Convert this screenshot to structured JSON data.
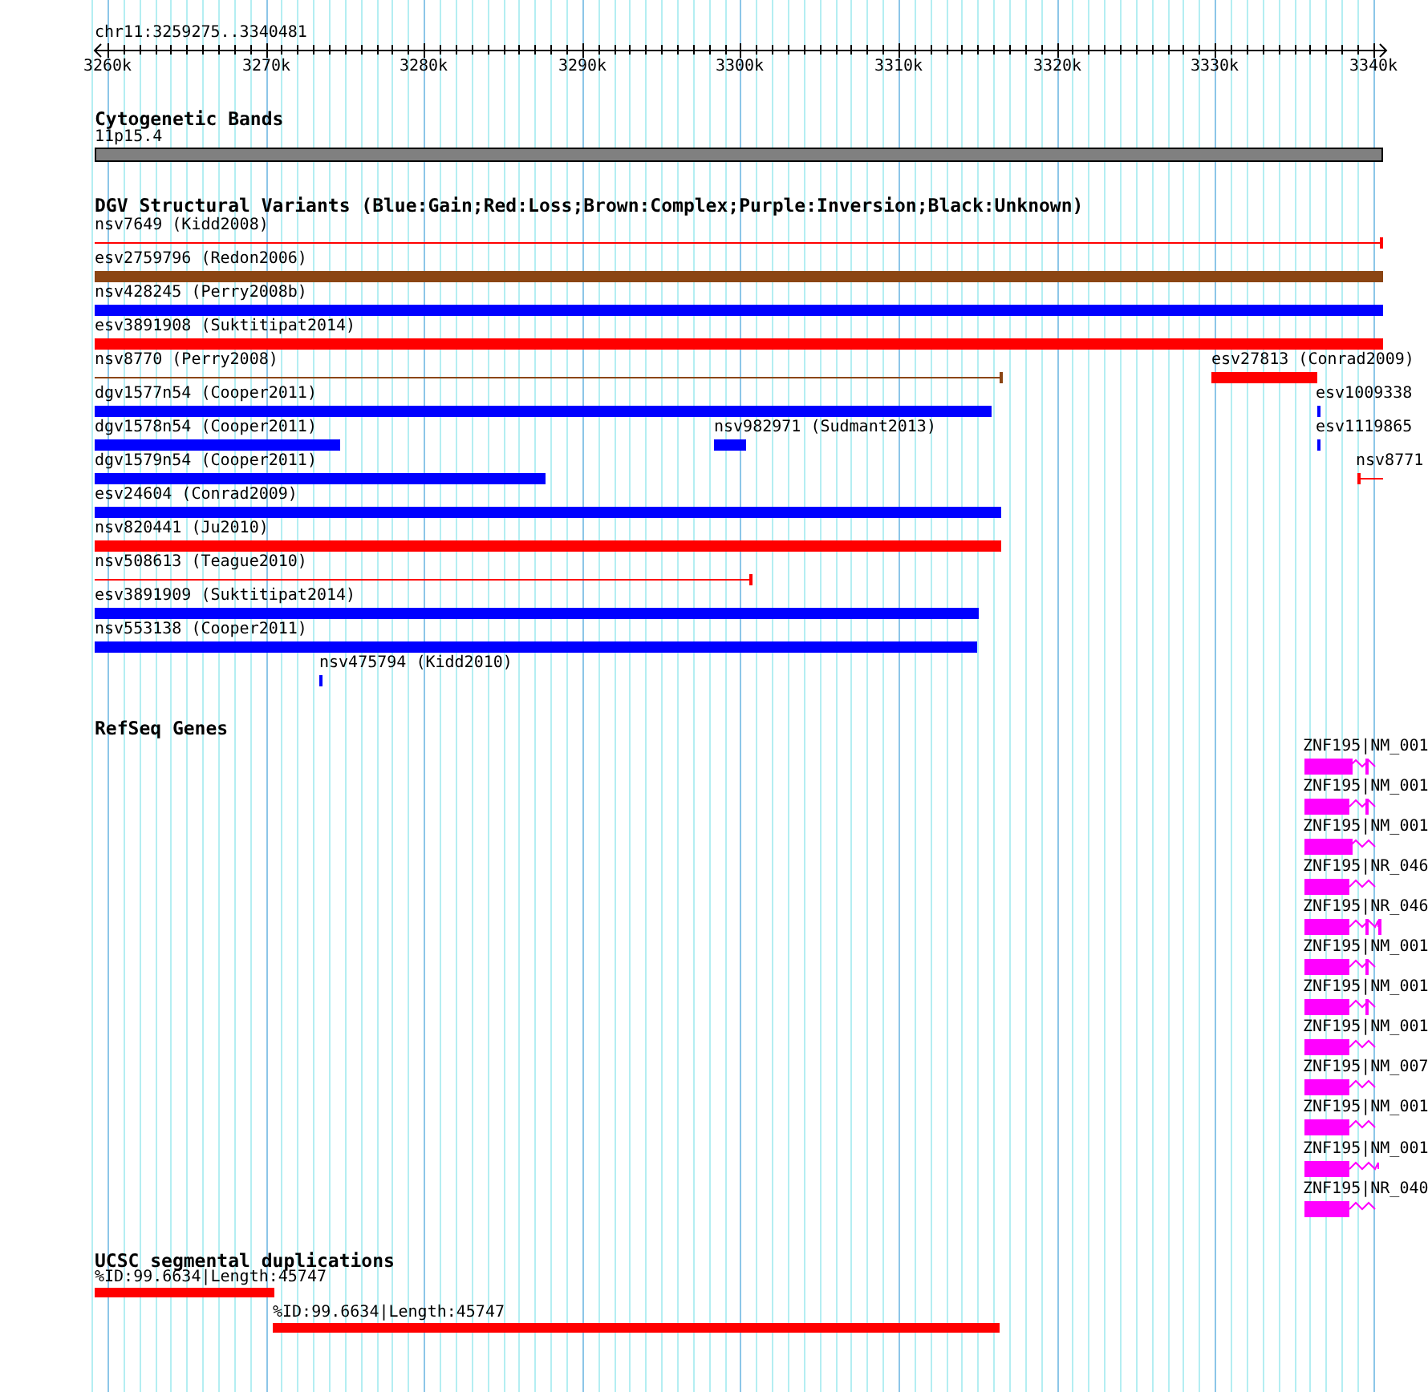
{
  "ruler": {
    "region": "chr11:3259275..3340481",
    "ticks": [
      "3260k",
      "3270k",
      "3280k",
      "3290k",
      "3300k",
      "3310k",
      "3320k",
      "3330k",
      "3340k"
    ]
  },
  "tracks": [
    {
      "kind": "cytoband",
      "title": "Cytogenetic Bands",
      "features": [
        {
          "label": "11p15.4"
        }
      ]
    },
    {
      "kind": "variants",
      "title": "DGV Structural Variants (Blue:Gain;Red:Loss;Brown:Complex;Purple:Inversion;Black:Unknown)",
      "features": [
        {
          "label": "nsv7649 (Kidd2008)",
          "kind": "line",
          "color": "#ff0000"
        },
        {
          "label": "esv2759796 (Redon2006)",
          "kind": "bar",
          "color": "#8b4513"
        },
        {
          "label": "nsv428245 (Perry2008b)",
          "kind": "bar",
          "color": "#0000ff"
        },
        {
          "label": "esv3891908 (Suktitipat2014)",
          "kind": "bar",
          "color": "#ff0000"
        },
        {
          "label": "nsv8770 (Perry2008)",
          "kind": "line",
          "color": "#8b4513"
        },
        {
          "label": "esv27813 (Conrad2009)",
          "kind": "bar",
          "color": "#ff0000"
        },
        {
          "label": "dgv1577n54 (Cooper2011)",
          "kind": "bar",
          "color": "#0000ff"
        },
        {
          "label": "esv1009338",
          "kind": "bar",
          "color": "#0000ff"
        },
        {
          "label": "dgv1578n54 (Cooper2011)",
          "kind": "bar",
          "color": "#0000ff"
        },
        {
          "label": "nsv982971 (Sudmant2013)",
          "kind": "bar",
          "color": "#0000ff"
        },
        {
          "label": "esv1119865",
          "kind": "bar",
          "color": "#0000ff"
        },
        {
          "label": "dgv1579n54 (Cooper2011)",
          "kind": "bar",
          "color": "#0000ff"
        },
        {
          "label": "nsv8771",
          "kind": "line",
          "color": "#ff0000"
        },
        {
          "label": "esv24604 (Conrad2009)",
          "kind": "bar",
          "color": "#0000ff"
        },
        {
          "label": "nsv820441 (Ju2010)",
          "kind": "bar",
          "color": "#ff0000"
        },
        {
          "label": "nsv508613 (Teague2010)",
          "kind": "line",
          "color": "#ff0000"
        },
        {
          "label": "esv3891909 (Suktitipat2014)",
          "kind": "bar",
          "color": "#0000ff"
        },
        {
          "label": "nsv553138 (Cooper2011)",
          "kind": "bar",
          "color": "#0000ff"
        },
        {
          "label": "nsv475794 (Kidd2010)",
          "kind": "bar",
          "color": "#0000ff"
        }
      ]
    },
    {
      "kind": "genes",
      "title": "RefSeq Genes",
      "features": [
        {
          "label": "ZNF195|NM_001"
        },
        {
          "label": "ZNF195|NM_001"
        },
        {
          "label": "ZNF195|NM_001"
        },
        {
          "label": "ZNF195|NR_046"
        },
        {
          "label": "ZNF195|NR_046"
        },
        {
          "label": "ZNF195|NM_001"
        },
        {
          "label": "ZNF195|NM_001"
        },
        {
          "label": "ZNF195|NM_001"
        },
        {
          "label": "ZNF195|NM_007"
        },
        {
          "label": "ZNF195|NM_001"
        },
        {
          "label": "ZNF195|NM_001"
        },
        {
          "label": "ZNF195|NR_040"
        }
      ]
    },
    {
      "kind": "segdup",
      "title": "UCSC segmental duplications",
      "features": [
        {
          "label": "%ID:99.6634|Length:45747"
        },
        {
          "label": "%ID:99.6634|Length:45747"
        }
      ]
    }
  ]
}
